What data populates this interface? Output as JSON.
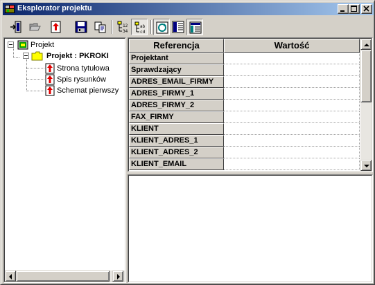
{
  "window": {
    "title": "Eksplorator projektu",
    "controls": [
      "minimize",
      "maximize",
      "close"
    ]
  },
  "toolbar": {
    "buttons": [
      {
        "name": "exit-icon",
        "pressed": false
      },
      {
        "name": "open-folder-icon",
        "pressed": false
      },
      {
        "name": "upload-document-icon",
        "pressed": false
      },
      {
        "name": "save-icon",
        "pressed": false
      },
      {
        "name": "copy-icon",
        "pressed": false
      },
      {
        "name": "tree-collapse-icon",
        "pressed": false
      },
      {
        "name": "tree-expand-icon",
        "pressed": true
      },
      {
        "name": "refresh-icon",
        "pressed": true
      },
      {
        "name": "list-view-icon",
        "pressed": false
      },
      {
        "name": "detail-view-icon",
        "pressed": true
      }
    ]
  },
  "tree": {
    "root": {
      "label": "Projekt",
      "icon": "project-icon"
    },
    "project": {
      "label": "Projekt : PKROKI",
      "icon": "folder-icon"
    },
    "items": [
      {
        "label": "Strona tytułowa",
        "icon": "document-red-icon"
      },
      {
        "label": "Spis rysunków",
        "icon": "document-red-icon"
      },
      {
        "label": "Schemat pierwszy",
        "icon": "document-red-icon"
      }
    ]
  },
  "grid": {
    "columns": [
      "Referencja",
      "Wartość"
    ],
    "rows": [
      {
        "ref": "Projektant",
        "value": ""
      },
      {
        "ref": "Sprawdzający",
        "value": ""
      },
      {
        "ref": "ADRES_EMAIL_FIRMY",
        "value": ""
      },
      {
        "ref": "ADRES_FIRMY_1",
        "value": ""
      },
      {
        "ref": "ADRES_FIRMY_2",
        "value": ""
      },
      {
        "ref": "FAX_FIRMY",
        "value": ""
      },
      {
        "ref": "KLIENT",
        "value": ""
      },
      {
        "ref": "KLIENT_ADRES_1",
        "value": ""
      },
      {
        "ref": "KLIENT_ADRES_2",
        "value": ""
      },
      {
        "ref": "KLIENT_EMAIL",
        "value": ""
      }
    ]
  },
  "description": {
    "text": ""
  },
  "colors": {
    "titlebar_start": "#0a246a",
    "titlebar_end": "#a6caf0",
    "face": "#d4d0c8"
  }
}
